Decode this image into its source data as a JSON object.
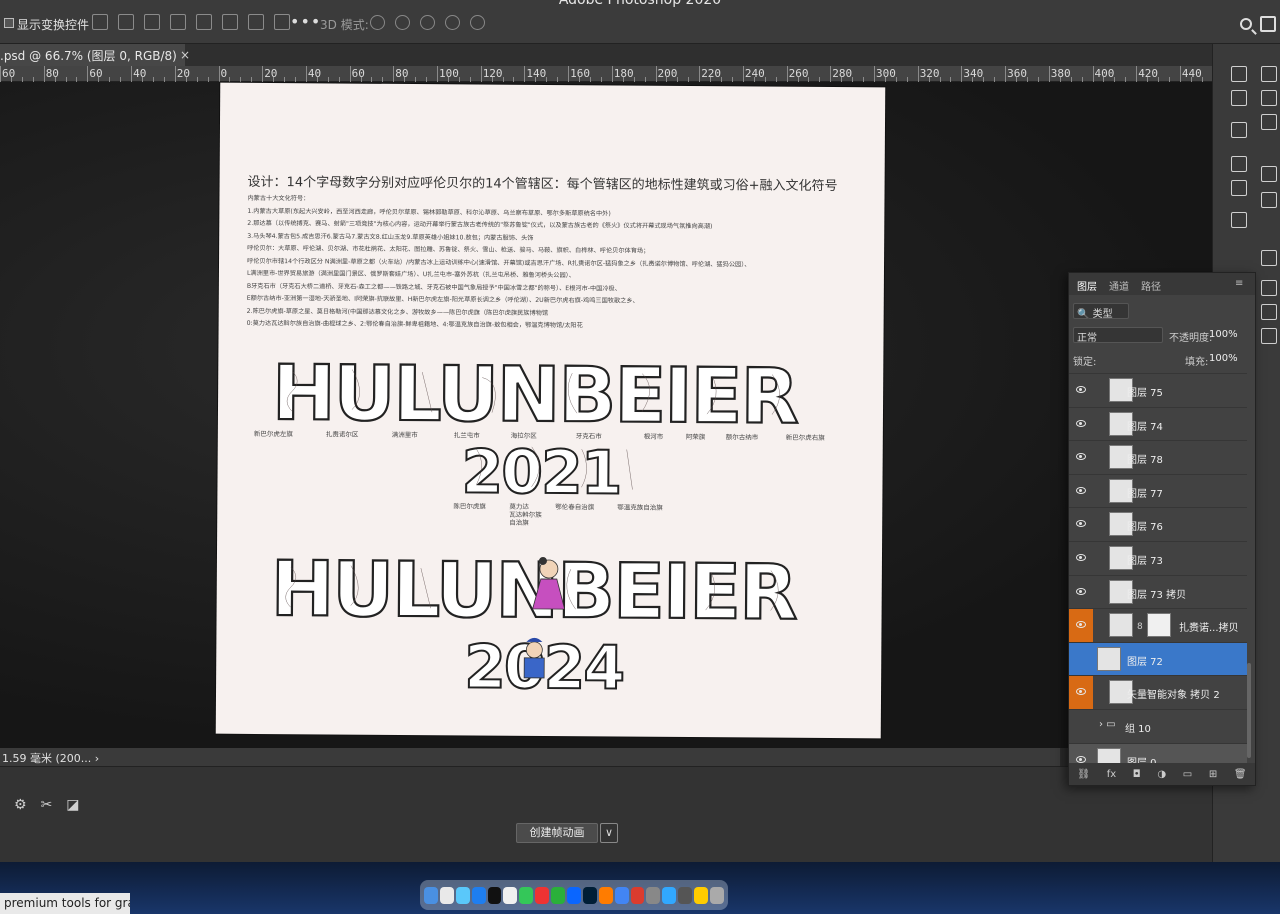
{
  "app": {
    "title": "Adobe Photoshop 2020"
  },
  "options_bar": {
    "show_transform_label": "显示变换控件",
    "more_label": "•••",
    "mode_3d_label": "3D 模式:"
  },
  "document_tab": {
    "label": ".psd @ 66.7% (图层 0, RGB/8)",
    "close_label": "×",
    "panel_chevron": "«"
  },
  "ruler": {
    "labels": [
      "60",
      "80",
      "60",
      "40",
      "20",
      "0",
      "20",
      "40",
      "60",
      "80",
      "100",
      "120",
      "140",
      "160",
      "180",
      "200",
      "220",
      "240",
      "260",
      "280",
      "300",
      "320",
      "340",
      "360",
      "380",
      "400",
      "420",
      "440"
    ]
  },
  "document": {
    "heading": "设计：14个字母数字分别对应呼伦贝尔的14个管辖区：每个管辖区的地标性建筑或习俗+融入文化符号",
    "lines": [
      "内蒙古十大文化符号：",
      "1.内蒙古大草原(东起大兴安岭，西至河西走廊，呼伦贝尔草原、锡林郭勒草原、科尔沁草原、乌兰察布草原、鄂尔多斯草原统名中外)",
      "2.那达慕（以传统搏克、赛马、射箭\"三项竞技\"为核心内容，运动开幕举行蒙古族古老传统的\"祭苏鲁锭\"仪式，以及蒙古族古老的《祭火》仪式将开幕式现场气氛推向高潮)",
      "3.马头琴4.蒙古包5.成吉思汗6.蒙古马7.蒙古文8.红山玉龙9.草原英雄小姐妹10.敖包；内蒙古服饰、头饰",
      "呼伦贝尔：大草原、呼伦湖、贝尔湖、市花杜鹃花、太阳花、图拉雕、苏鲁锭、祭火、雪山、枪送、骏马、马鞍、旗帜、白桦林、呼伦贝尔体育场；",
      "呼伦贝尔市辖14个行政区分 N满洲里-草原之都（火车站）/内蒙古冰上运动训练中心(速滑馆、开幕馆)或吉思汗广场、R扎赉诺尔区-猛犸象之乡（扎赉诺尔博物馆、呼伦湖、猛犸公园）、",
      "L满洲里市-世界贸易旅游（满洲里国门景区、俄罗斯套娃广场）、U扎兰屯市-塞外苏杭（扎兰屯吊桥、雅鲁河桥头公园）、",
      "B牙克石市（牙克石大桥二道桥、牙克石-森工之都——铁路之城、牙克石被中国气象局授予\"中国冰雪之都\"的称号）、E根河市-中国冷极、",
      "E额尔古纳市-亚洲第一湿地-天骄圣地、I阿荣旗-抗联故里、H新巴尔虎左旗-阳光草原长调之乡（呼伦湖）、2U新巴尔虎右旗-鸡鸣三国牧歌之乡、",
      "2.陈巴尔虎旗-草原之星、莫日格勒河(中国那达慕文化之乡、游牧故乡——陈巴尔虎旗（陈巴尔虎旗民族博物馆",
      "0:莫力达瓦达斡尔族自治旗-曲棍球之乡、2:鄂伦春自治旗-鲜卑祖籍地、4:鄂温克族自治旗-敖包相会，鄂温克博物馆/太阳花"
    ],
    "art_word": "HULUNBEIER",
    "art_year": "2021",
    "art_year_2": "2024",
    "region_labels_row1": [
      "新巴尔虎左旗",
      "扎赉诺尔区",
      "满洲里市",
      "扎兰屯市",
      "海拉尔区",
      "牙克石市",
      "根河市",
      "阿荣旗",
      "额尔古纳市",
      "新巴尔虎右旗"
    ],
    "region_labels_row2": [
      "陈巴尔虎旗",
      "莫力达\n瓦达斡尔族\n自治旗",
      "鄂伦春自治旗",
      "鄂温克族自治旗"
    ]
  },
  "status": {
    "text": "1.59 毫米 (200... ›"
  },
  "timeline": {
    "create_button": "创建帧动画",
    "dropdown": "∨"
  },
  "layers_panel": {
    "tabs": [
      "图层",
      "通道",
      "路径"
    ],
    "filter_label": "类型",
    "blend_mode": "正常",
    "opacity_label": "不透明度:",
    "opacity_value": "100%",
    "lock_label": "锁定:",
    "fill_label": "填充:",
    "fill_value": "100%",
    "layers": [
      {
        "name": "图层 75",
        "state": "normal"
      },
      {
        "name": "图层 74",
        "state": "normal"
      },
      {
        "name": "图层 78",
        "state": "normal"
      },
      {
        "name": "图层 77",
        "state": "normal"
      },
      {
        "name": "图层 76",
        "state": "normal"
      },
      {
        "name": "图层 73",
        "state": "normal"
      },
      {
        "name": "图层 73 拷贝",
        "state": "normal"
      },
      {
        "name": "扎赉诺...拷贝",
        "state": "orange"
      },
      {
        "name": "图层 72",
        "state": "blue"
      },
      {
        "name": "矢量智能对象 拷贝 2",
        "state": "orange"
      },
      {
        "name": "组 10",
        "state": "group"
      },
      {
        "name": "图层 0",
        "state": "selected"
      }
    ],
    "bottom_icons": [
      "link-icon",
      "fx-icon",
      "mask-icon",
      "adjustment-icon",
      "folder-icon",
      "new-layer-icon",
      "trash-icon"
    ]
  },
  "browser_tab": {
    "label": "premium tools for gra..."
  }
}
